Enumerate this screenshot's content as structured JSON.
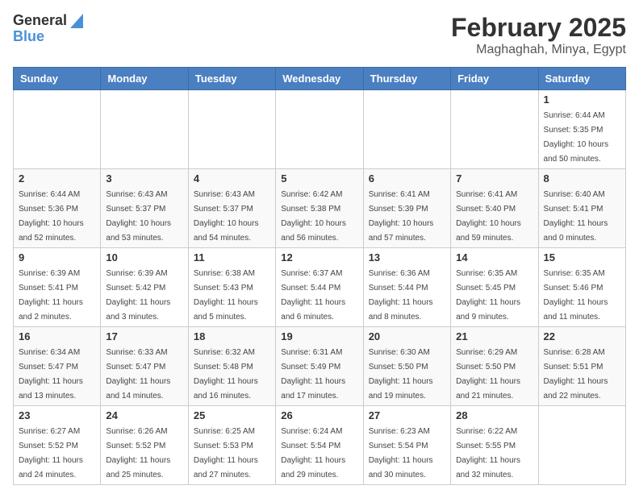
{
  "header": {
    "logo_general": "General",
    "logo_blue": "Blue",
    "title": "February 2025",
    "subtitle": "Maghaghah, Minya, Egypt"
  },
  "weekdays": [
    "Sunday",
    "Monday",
    "Tuesday",
    "Wednesday",
    "Thursday",
    "Friday",
    "Saturday"
  ],
  "weeks": [
    [
      {
        "day": "",
        "info": ""
      },
      {
        "day": "",
        "info": ""
      },
      {
        "day": "",
        "info": ""
      },
      {
        "day": "",
        "info": ""
      },
      {
        "day": "",
        "info": ""
      },
      {
        "day": "",
        "info": ""
      },
      {
        "day": "1",
        "info": "Sunrise: 6:44 AM\nSunset: 5:35 PM\nDaylight: 10 hours\nand 50 minutes."
      }
    ],
    [
      {
        "day": "2",
        "info": "Sunrise: 6:44 AM\nSunset: 5:36 PM\nDaylight: 10 hours\nand 52 minutes."
      },
      {
        "day": "3",
        "info": "Sunrise: 6:43 AM\nSunset: 5:37 PM\nDaylight: 10 hours\nand 53 minutes."
      },
      {
        "day": "4",
        "info": "Sunrise: 6:43 AM\nSunset: 5:37 PM\nDaylight: 10 hours\nand 54 minutes."
      },
      {
        "day": "5",
        "info": "Sunrise: 6:42 AM\nSunset: 5:38 PM\nDaylight: 10 hours\nand 56 minutes."
      },
      {
        "day": "6",
        "info": "Sunrise: 6:41 AM\nSunset: 5:39 PM\nDaylight: 10 hours\nand 57 minutes."
      },
      {
        "day": "7",
        "info": "Sunrise: 6:41 AM\nSunset: 5:40 PM\nDaylight: 10 hours\nand 59 minutes."
      },
      {
        "day": "8",
        "info": "Sunrise: 6:40 AM\nSunset: 5:41 PM\nDaylight: 11 hours\nand 0 minutes."
      }
    ],
    [
      {
        "day": "9",
        "info": "Sunrise: 6:39 AM\nSunset: 5:41 PM\nDaylight: 11 hours\nand 2 minutes."
      },
      {
        "day": "10",
        "info": "Sunrise: 6:39 AM\nSunset: 5:42 PM\nDaylight: 11 hours\nand 3 minutes."
      },
      {
        "day": "11",
        "info": "Sunrise: 6:38 AM\nSunset: 5:43 PM\nDaylight: 11 hours\nand 5 minutes."
      },
      {
        "day": "12",
        "info": "Sunrise: 6:37 AM\nSunset: 5:44 PM\nDaylight: 11 hours\nand 6 minutes."
      },
      {
        "day": "13",
        "info": "Sunrise: 6:36 AM\nSunset: 5:44 PM\nDaylight: 11 hours\nand 8 minutes."
      },
      {
        "day": "14",
        "info": "Sunrise: 6:35 AM\nSunset: 5:45 PM\nDaylight: 11 hours\nand 9 minutes."
      },
      {
        "day": "15",
        "info": "Sunrise: 6:35 AM\nSunset: 5:46 PM\nDaylight: 11 hours\nand 11 minutes."
      }
    ],
    [
      {
        "day": "16",
        "info": "Sunrise: 6:34 AM\nSunset: 5:47 PM\nDaylight: 11 hours\nand 13 minutes."
      },
      {
        "day": "17",
        "info": "Sunrise: 6:33 AM\nSunset: 5:47 PM\nDaylight: 11 hours\nand 14 minutes."
      },
      {
        "day": "18",
        "info": "Sunrise: 6:32 AM\nSunset: 5:48 PM\nDaylight: 11 hours\nand 16 minutes."
      },
      {
        "day": "19",
        "info": "Sunrise: 6:31 AM\nSunset: 5:49 PM\nDaylight: 11 hours\nand 17 minutes."
      },
      {
        "day": "20",
        "info": "Sunrise: 6:30 AM\nSunset: 5:50 PM\nDaylight: 11 hours\nand 19 minutes."
      },
      {
        "day": "21",
        "info": "Sunrise: 6:29 AM\nSunset: 5:50 PM\nDaylight: 11 hours\nand 21 minutes."
      },
      {
        "day": "22",
        "info": "Sunrise: 6:28 AM\nSunset: 5:51 PM\nDaylight: 11 hours\nand 22 minutes."
      }
    ],
    [
      {
        "day": "23",
        "info": "Sunrise: 6:27 AM\nSunset: 5:52 PM\nDaylight: 11 hours\nand 24 minutes."
      },
      {
        "day": "24",
        "info": "Sunrise: 6:26 AM\nSunset: 5:52 PM\nDaylight: 11 hours\nand 25 minutes."
      },
      {
        "day": "25",
        "info": "Sunrise: 6:25 AM\nSunset: 5:53 PM\nDaylight: 11 hours\nand 27 minutes."
      },
      {
        "day": "26",
        "info": "Sunrise: 6:24 AM\nSunset: 5:54 PM\nDaylight: 11 hours\nand 29 minutes."
      },
      {
        "day": "27",
        "info": "Sunrise: 6:23 AM\nSunset: 5:54 PM\nDaylight: 11 hours\nand 30 minutes."
      },
      {
        "day": "28",
        "info": "Sunrise: 6:22 AM\nSunset: 5:55 PM\nDaylight: 11 hours\nand 32 minutes."
      },
      {
        "day": "",
        "info": ""
      }
    ]
  ]
}
